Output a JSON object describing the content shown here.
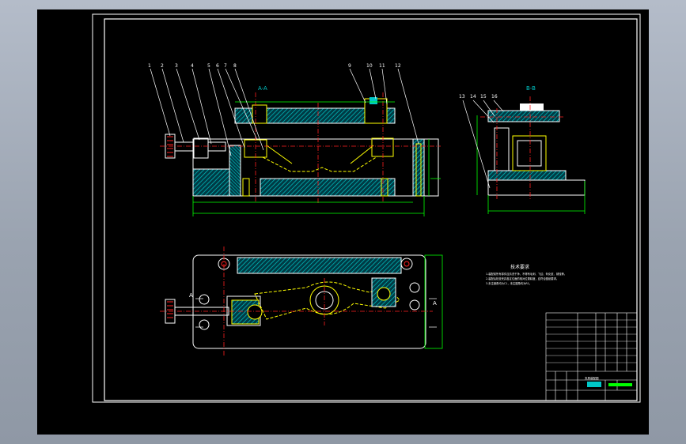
{
  "drawing": {
    "section_label_front": "A-A",
    "section_label_side": "B-B",
    "section_arrow_left": "A",
    "section_arrow_right": "A",
    "callouts_front": [
      "1",
      "2",
      "3",
      "4",
      "5",
      "6",
      "7",
      "8",
      "9",
      "10",
      "11",
      "12"
    ],
    "callouts_side": [
      "13",
      "14",
      "15",
      "16"
    ],
    "tech_requirements_title": "技术要求",
    "tech_requirements_lines": [
      "1.装配前所有零件应清洗干净，不得有毛刺、飞边、氧化皮、锈蚀等。",
      "2.装配后检查夹具各定位面的相对位置精度，应符合图纸要求。",
      "3.未注倒角均为C1，未注圆角均为R1。"
    ],
    "title_block_label": "夹具装配图"
  },
  "colors": {
    "outline": "#ffffff",
    "section_hatch": "#00c8c8",
    "part_outline": "#ffff00",
    "dimension": "#00ff00",
    "centerline": "#ff2020",
    "leader": "#ffffff"
  }
}
